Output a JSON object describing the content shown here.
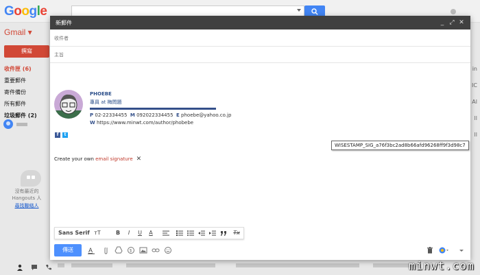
{
  "app": {
    "logo_text": "Google",
    "gmail_label": "Gmail ▾",
    "compose_button": "撰寫"
  },
  "nav": {
    "items": [
      {
        "label": "收件匣 (6)"
      },
      {
        "label": "重要郵件"
      },
      {
        "label": "寄件備份"
      },
      {
        "label": "所有郵件"
      },
      {
        "label": "垃圾郵件 (2)"
      }
    ]
  },
  "hangouts": {
    "empty_text": "沒有最近的 Hangouts 人",
    "find_link": "尋找聯絡人"
  },
  "compose": {
    "title": "新郵件",
    "to_placeholder": "收件者",
    "subject_placeholder": "主旨",
    "minimize": "_",
    "expand": "⤢",
    "close": "✕",
    "signature": {
      "name": "PHOEBE",
      "role": "專員 at 梅問題",
      "phone_label": "P",
      "phone": "02-22334455",
      "mobile_label": "M",
      "mobile": "092022334455",
      "email_label": "E",
      "email": "phoebe@yahoo.co.jp",
      "web_label": "W",
      "web": "https://www.minwt.com/author/phobebe"
    },
    "social": {
      "facebook": "f",
      "twitter": "t"
    },
    "tooltip": "WISESTAMP_SIG_a76f3bc2ad8b66afd96268ff9f3d98c7",
    "create_prefix": "Create your own ",
    "create_link": "email signature",
    "create_close": "✕",
    "format_toolbar": {
      "font": "Sans Serif",
      "size": "тT",
      "bold": "B",
      "italic": "I",
      "underline": "U",
      "text_color": "A",
      "clear": "Tx"
    },
    "send_button": "傳送"
  },
  "watermark": "minwt.com",
  "colors": {
    "gmail_red": "#d14836",
    "send_blue": "#4d90fe",
    "sig_blue": "#34508a"
  }
}
